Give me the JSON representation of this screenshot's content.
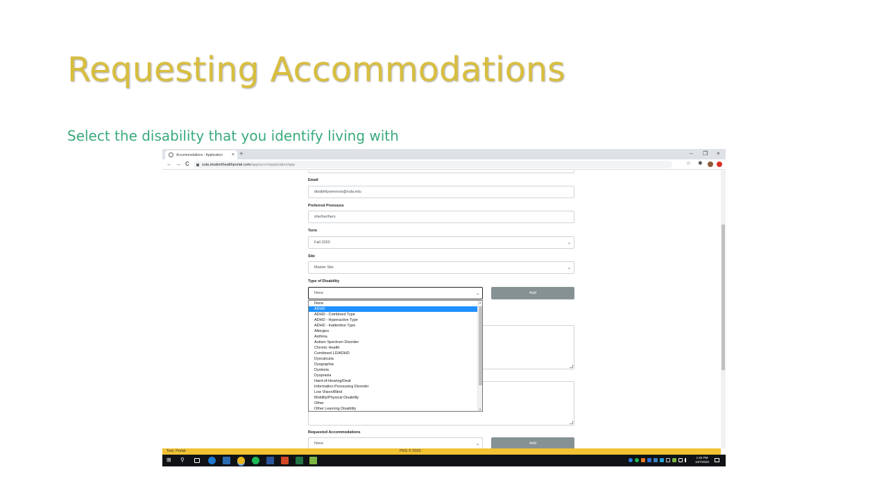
{
  "slide": {
    "title": "Requesting Accommodations",
    "subtitle": "Select the disability that you identify living with",
    "title_color": "#d8be3e",
    "subtitle_color": "#3aaa7c"
  },
  "browser": {
    "tab_title": "Accommodations - Application",
    "tab_close": "×",
    "new_tab": "+",
    "window_controls": {
      "minimize": "–",
      "restore": "❐",
      "close": "×"
    },
    "nav": {
      "back": "←",
      "forward": "→",
      "reload": "C"
    },
    "url_host": "xula.studenthealthportal.com",
    "url_path": "/app/accm/application/app",
    "star": "☆",
    "extensions": "✱"
  },
  "form": {
    "email": {
      "label": "Email",
      "value": "disabilityservices@xula.edu"
    },
    "pronouns": {
      "label": "Preferred Pronouns",
      "value": "she/her/hers"
    },
    "term": {
      "label": "Term",
      "value": "Fall 2020"
    },
    "site": {
      "label": "Site",
      "value": "Master Site"
    },
    "disability": {
      "label": "Type of Disability",
      "value": "None",
      "add_label": "Add"
    },
    "accommodations": {
      "label": "Requested Accommodations",
      "value": "None",
      "add_label": "Add"
    },
    "caret": "⌄"
  },
  "dropdown": {
    "selected_index": 1,
    "options": [
      "None",
      "ADHD",
      "ADHD - Combined Type",
      "ADHD - Hyperactive Type",
      "ADHD - Inattentive Type",
      "Allergies",
      "Asthma",
      "Autism Spectrum Disorder",
      "Chronic Health",
      "Combined LD/ADHD",
      "Dyscalculia",
      "Dysgraphia",
      "Dyslexia",
      "Dyspraxia",
      "Hard-of-Hearing/Deaf",
      "Information Processing Disorder",
      "Low Vision/Blind",
      "Mobility/Physical Disability",
      "Other",
      "Other Learning Disability"
    ]
  },
  "statusbar": {
    "user": "Test, Portal",
    "copyright": "PHS © 2020"
  },
  "taskbar": {
    "start": "⊞",
    "search": "⚲",
    "clock_time": "1:20 PM",
    "clock_date": "10/7/2020"
  },
  "colors": {
    "status_bar": "#f2c234",
    "add_button": "#869194",
    "selected_option": "#1e90ff",
    "taskbar": "#101216"
  }
}
